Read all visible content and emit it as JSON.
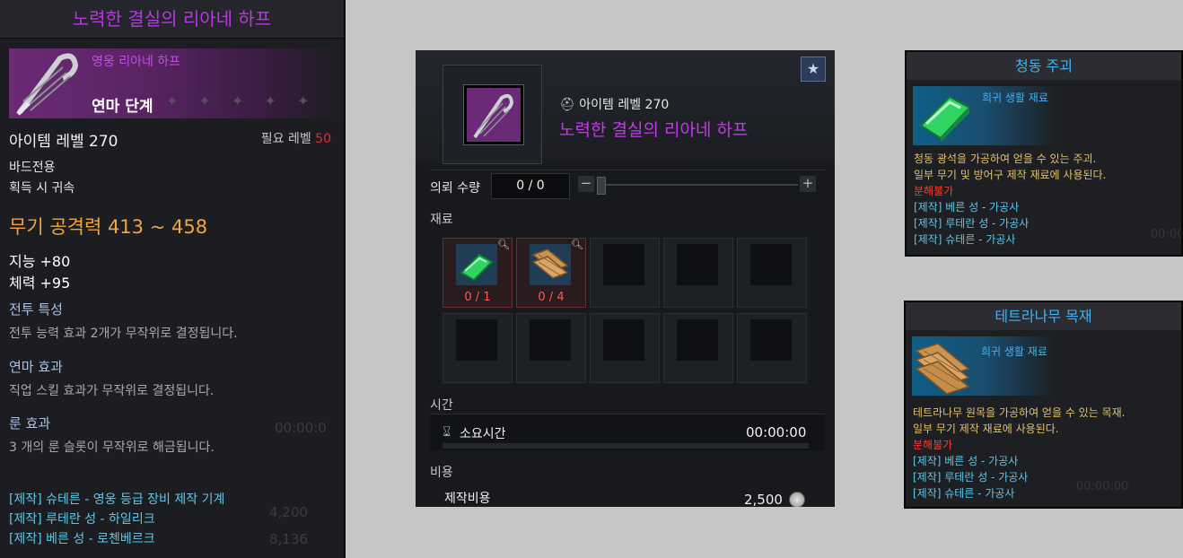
{
  "left_tooltip": {
    "title": "노력한 결실의 리아네 하프",
    "grade": "영웅 리아네 하프",
    "stage": "연마 단계",
    "stars": "✦ ✦ ✦ ✦ ✦",
    "item_level": "아이템 레벨 270",
    "required_level_label": "필요 레벨",
    "required_level_value": "50",
    "class_restriction": "바드전용",
    "bind_on_acquire": "획득 시 귀속",
    "weapon_attack": "무기 공격력 413 ~ 458",
    "stat_int": "지능 +80",
    "stat_vit": "체력 +95",
    "battle_trait_header": "전투 특성",
    "battle_trait_desc": "전투 능력 효과 2개가 무작위로 결정됩니다.",
    "refine_header": "연마 효과",
    "refine_desc": "직업 스킬 효과가 무작위로 결정됩니다.",
    "rune_header": "룬 효과",
    "rune_desc": "3 개의 룬 슬롯이 무작위로 해금됩니다.",
    "crafting_locations": [
      "[제작] 슈테른 - 영웅 등급 장비 제작 기계",
      "[제작] 루테란 성 - 하일리크",
      "[제작] 베른 성 - 로첸베르크"
    ],
    "ghost_time": "00:00:0",
    "ghost_cost1": "4,200",
    "ghost_cost2": "8,136"
  },
  "craft_panel": {
    "item_level": "아이템 레벨 270",
    "item_name": "노력한 결실의 리아네 하프",
    "favorite_icon": "★",
    "request_qty_label": "의뢰 수량",
    "request_qty_value": "0 / 0",
    "minus": "−",
    "plus": "+",
    "materials_header": "재료",
    "materials": [
      {
        "name": "청동 주괴",
        "count": "0 / 1"
      },
      {
        "name": "테트라나무 목재",
        "count": "0 / 4"
      }
    ],
    "time_header": "시간",
    "time_label": "소요시간",
    "time_value": "00:00:00",
    "cost_header": "비용",
    "cost_label": "제작비용",
    "cost_value": "2,500"
  },
  "card_bronze": {
    "title": "청동 주괴",
    "type": "희귀 생활 재료",
    "desc1": "청동 광석을 가공하여 얻을 수 있는 주괴.",
    "desc2": "일부 무기 및 방어구 제작 재료에 사용된다.",
    "no_disassemble": "분해불가",
    "sources": [
      "[제작] 베른 성 - 가공사",
      "[제작] 루테란 성 - 가공사",
      "[제작] 슈테른 - 가공사"
    ],
    "ghost": "00:00:0"
  },
  "card_wood": {
    "title": "테트라나무 목재",
    "type": "희귀 생활 재료",
    "desc1": "테트라나무 원목을 가공하여 얻을 수 있는 목재.",
    "desc2": "일부 무기 제작 재료에 사용된다.",
    "no_disassemble": "분해불가",
    "sources": [
      "[제작] 베른 성 - 가공사",
      "[제작] 루테란 성 - 가공사",
      "[제작] 슈테른 - 가공사"
    ],
    "ghost": "00:00:00"
  }
}
